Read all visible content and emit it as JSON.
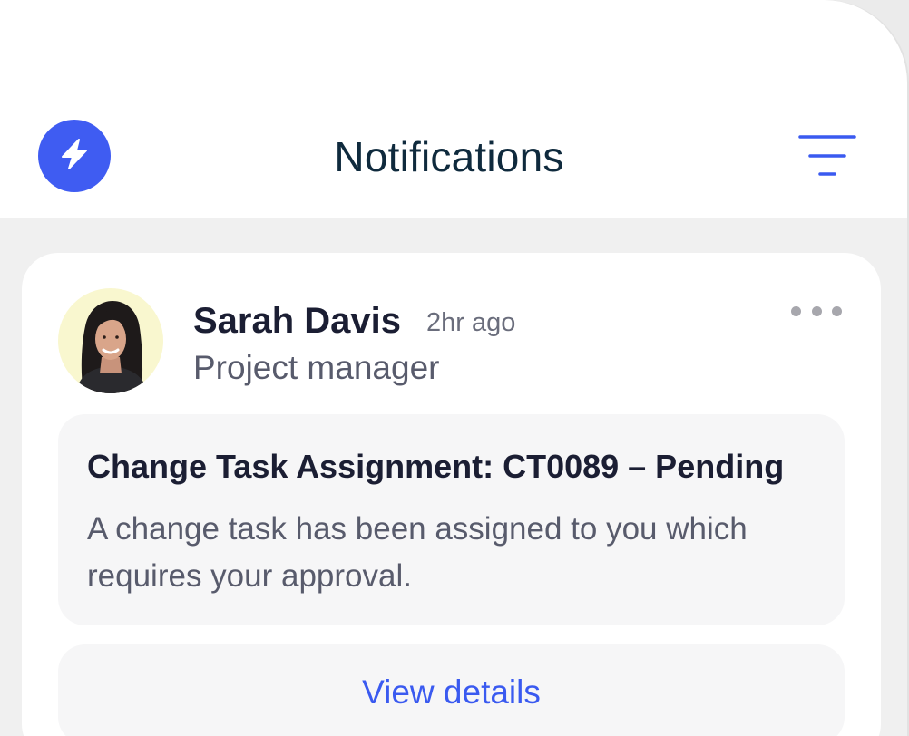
{
  "header": {
    "title": "Notifications",
    "logo_icon": "lightning-bolt-icon",
    "filter_icon": "filter-lines-icon"
  },
  "notification": {
    "sender_name": "Sarah Davis",
    "timestamp": "2hr ago",
    "role": "Project manager",
    "more_icon": "more-horizontal-icon",
    "message_title": "Change Task Assignment: CT0089 – Pending",
    "message_body": "A change task has been assigned to you which requires your approval.",
    "action_label": "View details"
  },
  "colors": {
    "accent": "#3f5cf2",
    "title_text": "#0f2a3d",
    "primary_text": "#1b1e33",
    "secondary_text": "#585b6c",
    "link": "#3a5af0",
    "screen_bg": "#f0f0f0",
    "card_bg": "#ffffff",
    "inner_bg": "#f6f6f7",
    "avatar_bg": "#f9f7cf"
  }
}
